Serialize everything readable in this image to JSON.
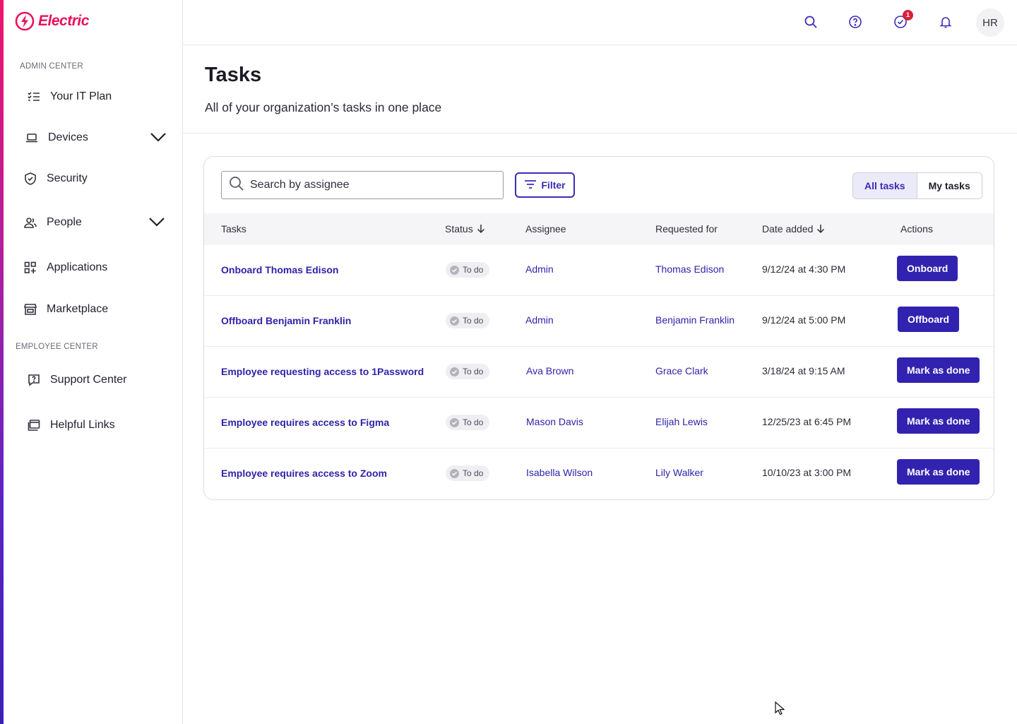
{
  "brand": {
    "name": "Electric",
    "accent": "#e8125c",
    "primary": "#3222b0"
  },
  "sidebar": {
    "sections": [
      {
        "label": "ADMIN CENTER"
      },
      {
        "label": "EMPLOYEE CENTER"
      }
    ],
    "items": [
      {
        "label": "Your IT Plan",
        "icon": "checklist-icon"
      },
      {
        "label": "Devices",
        "icon": "laptop-icon",
        "expandable": true
      },
      {
        "label": "Security",
        "icon": "shield-icon"
      },
      {
        "label": "People",
        "icon": "people-icon",
        "expandable": true
      },
      {
        "label": "Applications",
        "icon": "apps-grid-icon"
      },
      {
        "label": "Marketplace",
        "icon": "store-icon"
      },
      {
        "label": "Support Center",
        "icon": "support-chat-icon"
      },
      {
        "label": "Helpful Links",
        "icon": "links-icon"
      }
    ]
  },
  "topbar": {
    "notifications_badge": "1",
    "avatar_initials": "HR"
  },
  "header": {
    "title": "Tasks",
    "subtitle": "All of your organization’s tasks in one place"
  },
  "toolbar": {
    "search_placeholder": "Search by assignee",
    "filter_label": "Filter",
    "tabs": [
      {
        "label": "All tasks",
        "active": true
      },
      {
        "label": "My tasks",
        "active": false
      }
    ]
  },
  "table": {
    "columns": [
      {
        "label": "Tasks",
        "sortable": false
      },
      {
        "label": "Status",
        "sortable": true
      },
      {
        "label": "Assignee",
        "sortable": false
      },
      {
        "label": "Requested for",
        "sortable": false
      },
      {
        "label": "Date added",
        "sortable": true
      },
      {
        "label": "Actions",
        "sortable": false
      }
    ],
    "rows": [
      {
        "task": "Onboard Thomas Edison",
        "status": "To do",
        "assignee": "Admin",
        "requested_for": "Thomas Edison",
        "date": "9/12/24 at 4:30 PM",
        "action": "Onboard"
      },
      {
        "task": "Offboard Benjamin Franklin",
        "status": "To do",
        "assignee": "Admin",
        "requested_for": "Benjamin Franklin",
        "date": "9/12/24 at 5:00 PM",
        "action": "Offboard"
      },
      {
        "task": "Employee requesting access to 1Password",
        "status": "To do",
        "assignee": "Ava Brown",
        "requested_for": "Grace Clark",
        "date": "3/18/24 at 9:15 AM",
        "action": "Mark as done"
      },
      {
        "task": "Employee requires access to Figma",
        "status": "To do",
        "assignee": "Mason Davis",
        "requested_for": "Elijah Lewis",
        "date": "12/25/23 at 6:45 PM",
        "action": "Mark as done"
      },
      {
        "task": "Employee requires access to Zoom",
        "status": "To do",
        "assignee": "Isabella Wilson",
        "requested_for": "Lily Walker",
        "date": "10/10/23 at 3:00 PM",
        "action": "Mark as done"
      }
    ]
  }
}
